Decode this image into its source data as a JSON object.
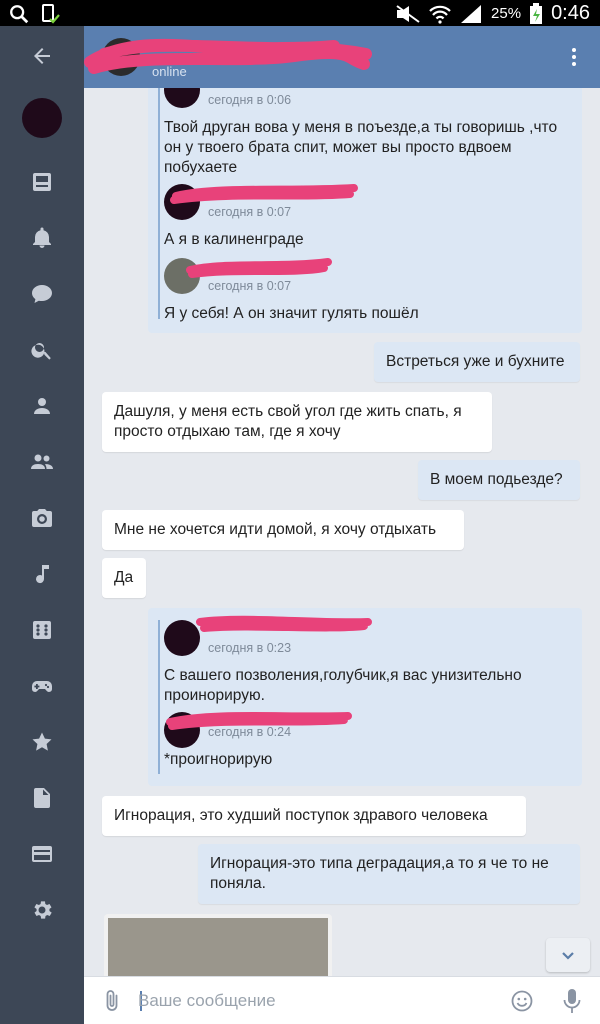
{
  "statusbar": {
    "battery": "25%",
    "time": "0:46"
  },
  "header": {
    "contact_status": "online"
  },
  "messages": {
    "fwd1": {
      "time1": "сегодня в 0:06",
      "text1": "Твой друган вова у меня в поъезде,а ты говоришь ,что он у твоего брата спит, может вы просто вдвоем побухаете",
      "time2": "сегодня в 0:07",
      "text2": "А я в калиненграде",
      "time3": "сегодня в 0:07",
      "text3": "Я у себя! А он значит гулять пошёл"
    },
    "out1": "Встреться уже и бухните",
    "in1": "Дашуля, у меня есть свой угол где жить спать, я просто отдыхаю там, где я хочу",
    "out2": "В моем подьезде?",
    "in2": "Мне не хочется идти домой, я хочу отдыхать",
    "in3": "Да",
    "fwd2": {
      "time1": "сегодня в 0:23",
      "text1": "С вашего позволения,голубчик,я вас унизительно проинорирую.",
      "time2": "сегодня в 0:24",
      "text2": "*проигнорирую"
    },
    "in4": "Игнорация,  это худший поступок здравого человека",
    "out3": "Игнорация-это типа деградация,а то я че то не поняла."
  },
  "composer": {
    "placeholder": "Ваше сообщение"
  },
  "colors": {
    "header": "#5a7fb0",
    "sidebar": "#3d4756",
    "outgoing": "#dce7f4",
    "scribble": "#e8427a"
  }
}
